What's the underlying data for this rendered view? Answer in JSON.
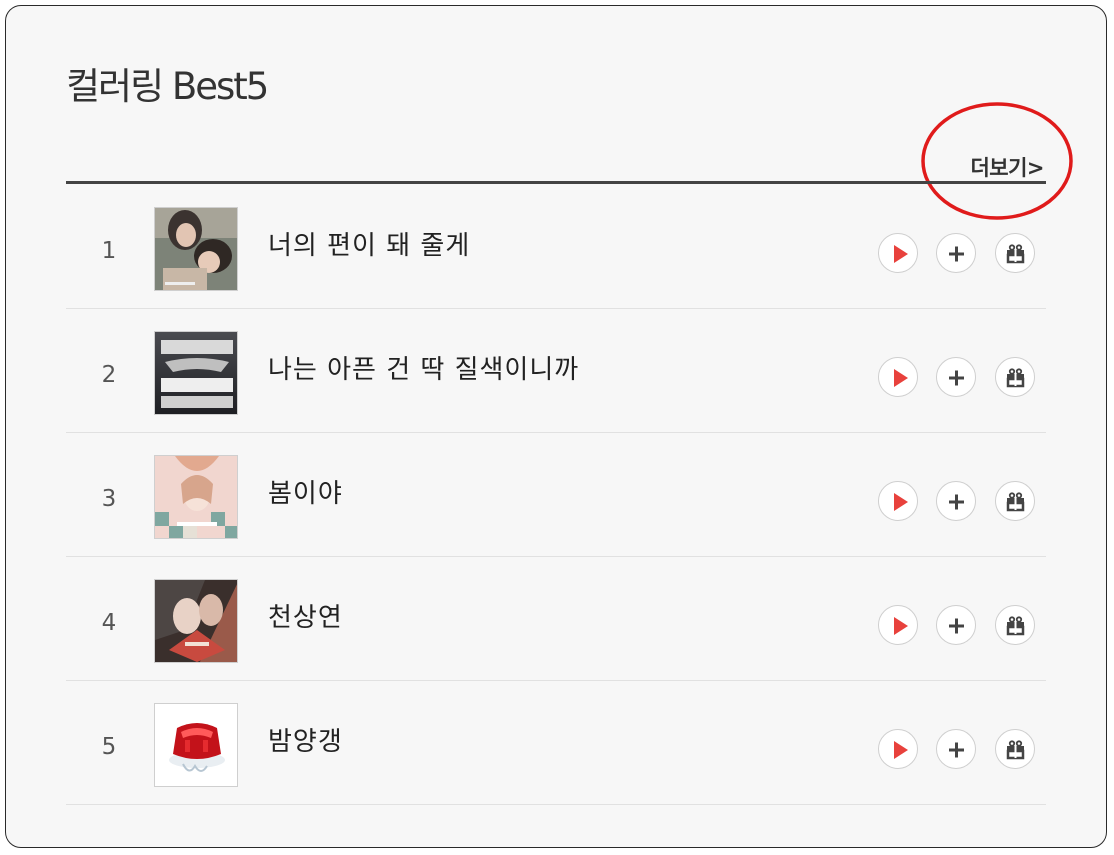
{
  "widget": {
    "title": "컬러링 Best5",
    "more_label": "더보기>"
  },
  "annotation": {
    "color": "#e01b1b",
    "shape": "ellipse around more link"
  },
  "colors": {
    "play_accent": "#e8413c",
    "icon_dark": "#444444"
  },
  "songs": [
    {
      "rank": "1",
      "title": "너의 편이 돼 줄게",
      "cover_icon": "album-cover-two-women"
    },
    {
      "rank": "2",
      "title": "나는 아픈 건 딱 질색이니까",
      "cover_icon": "album-cover-gidle-second-full-album"
    },
    {
      "rank": "3",
      "title": "봄이야",
      "cover_icon": "album-cover-flutter"
    },
    {
      "rank": "4",
      "title": "천상연",
      "cover_icon": "album-cover-illustration"
    },
    {
      "rank": "5",
      "title": "밤양갱",
      "cover_icon": "album-cover-red-jelly"
    }
  ],
  "row_actions": [
    {
      "name": "play",
      "icon": "play-icon"
    },
    {
      "name": "add",
      "icon": "plus-icon"
    },
    {
      "name": "gift",
      "icon": "gift-icon"
    }
  ]
}
